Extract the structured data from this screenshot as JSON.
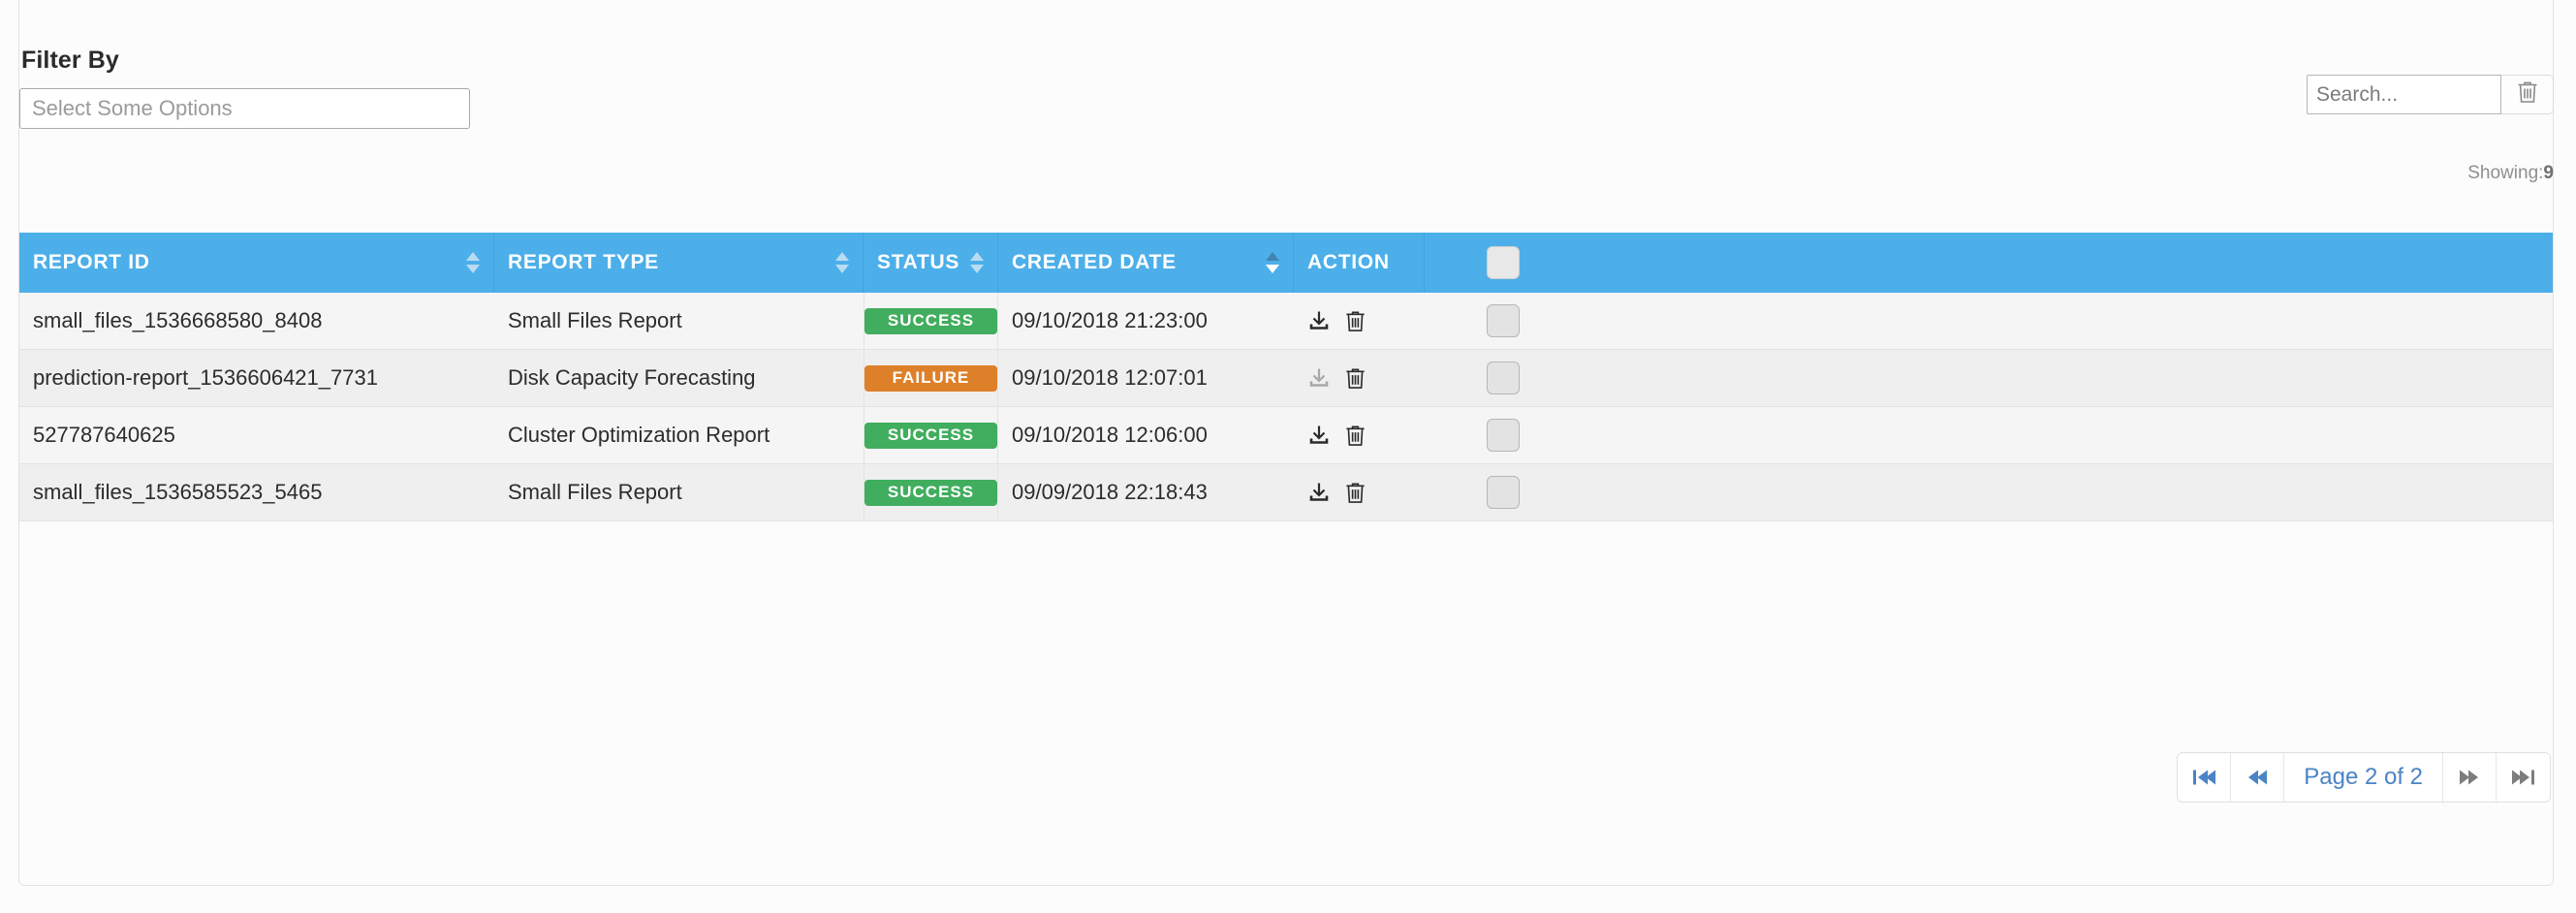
{
  "filter": {
    "label": "Filter By",
    "select_placeholder": "Select Some Options",
    "select_value": ""
  },
  "search": {
    "placeholder": "Search...",
    "value": "",
    "clear_icon": "trash-icon"
  },
  "showing": {
    "prefix": "Showing:",
    "count": "9"
  },
  "table": {
    "columns": [
      {
        "label": "REPORT ID",
        "sortable": true,
        "sorted": false
      },
      {
        "label": "REPORT TYPE",
        "sortable": true,
        "sorted": false
      },
      {
        "label": "STATUS",
        "sortable": true,
        "sorted": false
      },
      {
        "label": "CREATED DATE",
        "sortable": true,
        "sorted": true
      },
      {
        "label": "ACTION",
        "sortable": false,
        "sorted": false
      }
    ],
    "select_all_checked": false,
    "rows": [
      {
        "report_id": "small_files_1536668580_8408",
        "report_type": "Small Files Report",
        "status": "SUCCESS",
        "status_color": "#41ad5e",
        "created_date": "09/10/2018 21:23:00",
        "download_enabled": true,
        "checked": false
      },
      {
        "report_id": "prediction-report_1536606421_7731",
        "report_type": "Disk Capacity Forecasting",
        "status": "FAILURE",
        "status_color": "#de8029",
        "created_date": "09/10/2018 12:07:01",
        "download_enabled": false,
        "checked": false
      },
      {
        "report_id": "527787640625",
        "report_type": "Cluster Optimization Report",
        "status": "SUCCESS",
        "status_color": "#41ad5e",
        "created_date": "09/10/2018 12:06:00",
        "download_enabled": true,
        "checked": false
      },
      {
        "report_id": "small_files_1536585523_5465",
        "report_type": "Small Files Report",
        "status": "SUCCESS",
        "status_color": "#41ad5e",
        "created_date": "09/09/2018 22:18:43",
        "download_enabled": true,
        "checked": false
      }
    ],
    "header_color": "#4cafe9"
  },
  "pagination": {
    "first_icon": "skip-to-start-icon",
    "prev_icon": "rewind-icon",
    "page_label": "Page 2 of 2",
    "next_icon": "fast-forward-icon",
    "last_icon": "skip-to-end-icon",
    "first_enabled": true,
    "prev_enabled": true,
    "next_enabled": false,
    "last_enabled": false,
    "enabled_color": "#4a84c4",
    "disabled_color": "#7d7d7d"
  }
}
